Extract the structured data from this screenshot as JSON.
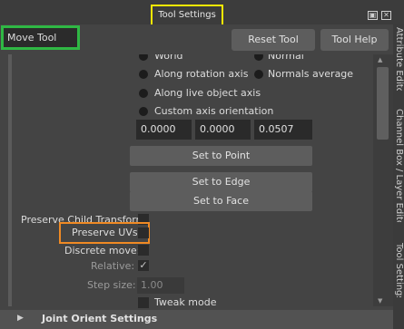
{
  "titlebar": {
    "title": "Tool Settings",
    "restore_glyph": "▣",
    "close_glyph": "✕"
  },
  "header": {
    "tool_name": "Move Tool",
    "reset_label": "Reset Tool",
    "help_label": "Tool Help"
  },
  "axis": {
    "world_label": "World",
    "normal_label": "Normal",
    "along_rotation_label": "Along rotation axis",
    "normals_average_label": "Normals average",
    "along_live_label": "Along live object axis",
    "custom_label": "Custom axis orientation",
    "values": [
      "0.0000",
      "0.0000",
      "0.0507"
    ]
  },
  "buttons": {
    "point": "Set to Point",
    "edge": "Set to Edge",
    "face": "Set to Face"
  },
  "options": {
    "preserve_child": "Preserve Child Transform",
    "preserve_uvs": "Preserve UVs",
    "discrete_move": "Discrete move:",
    "relative": "Relative:",
    "step_size": "Step size:",
    "step_value": "1.00",
    "tweak_mode": "Tweak mode",
    "check_glyph": "✓"
  },
  "section": {
    "title": "Joint Orient Settings",
    "arrow_glyph": "▶"
  },
  "side_tabs": [
    "Attribute Editor",
    "Channel Box / Layer Editor",
    "Tool Settings"
  ],
  "colors": {
    "title_highlight": "#ffe800",
    "tool_name_highlight": "#2fb844",
    "preserve_uvs_highlight": "#f08a24"
  }
}
